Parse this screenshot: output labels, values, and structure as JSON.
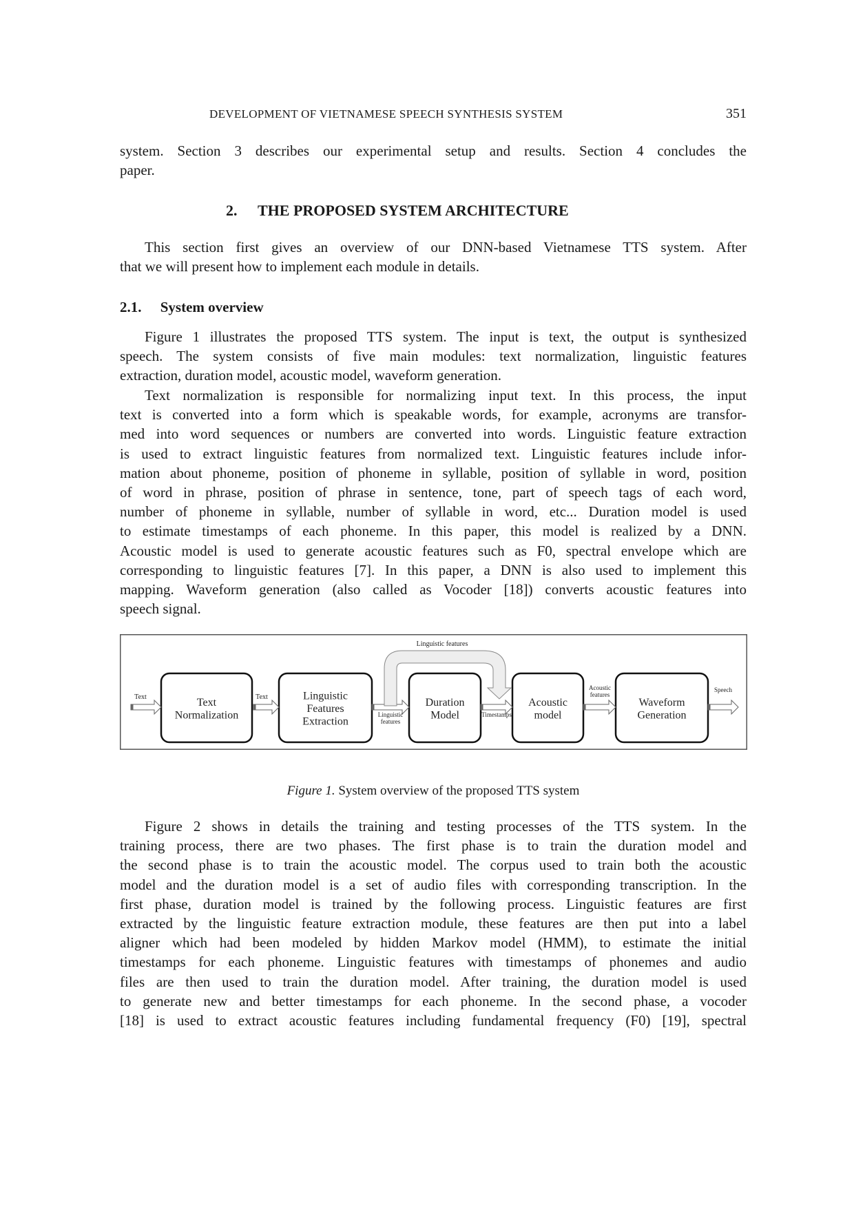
{
  "header": {
    "title": "DEVELOPMENT OF VIETNAMESE SPEECH SYNTHESIS SYSTEM",
    "page_number": "351"
  },
  "intro_tail": [
    "system.  Section 3 describes our experimental setup and results.  Section 4 concludes the",
    "paper."
  ],
  "section": {
    "number": "2.",
    "title": "THE PROPOSED SYSTEM ARCHITECTURE"
  },
  "section_para": [
    "This section first gives an overview of our DNN-based Vietnamese TTS system.  After",
    "that we will present how to implement each module in details."
  ],
  "subsection": {
    "number": "2.1.",
    "title": "System overview"
  },
  "para_overview": [
    "Figure 1 illustrates the proposed TTS system. The input is text, the output is synthesized",
    "speech.  The system consists of five main modules:  text normalization, linguistic features",
    "extraction, duration model, acoustic model, waveform generation."
  ],
  "para_modules": [
    "Text normalization is responsible for normalizing input text. In this process, the input",
    "text is converted into a form which is speakable words, for example, acronyms are transfor-",
    "med into word sequences or numbers are converted into words. Linguistic feature extraction",
    "is used to extract linguistic features from normalized text. Linguistic features include infor-",
    "mation about phoneme, position of phoneme in syllable, position of syllable in word, position",
    "of word in phrase, position of phrase in sentence, tone, part of speech tags of each word,",
    "number of phoneme in syllable, number of syllable in word, etc...  Duration model is used",
    "to estimate timestamps of each phoneme. In this paper, this model is realized by a DNN.",
    "Acoustic model is used to generate acoustic features such as F0, spectral envelope which are",
    "corresponding to linguistic features [7]. In this paper, a DNN is also used to implement this",
    "mapping. Waveform generation (also called as Vocoder [18]) converts acoustic features into",
    "speech signal."
  ],
  "figure": {
    "modules": [
      {
        "lines": [
          "Text",
          "Normalization"
        ]
      },
      {
        "lines": [
          "Linguistic",
          "Features",
          "Extraction"
        ]
      },
      {
        "lines": [
          "Duration",
          "Model"
        ]
      },
      {
        "lines": [
          "Acoustic",
          "model"
        ]
      },
      {
        "lines": [
          "Waveform",
          "Generation"
        ]
      }
    ],
    "arrow_labels": {
      "input": "Text",
      "text": "Text",
      "linguistic_1": "Linguistic",
      "linguistic_2": "features",
      "timestamps": "Timestamps",
      "acoustic_1": "Acoustic",
      "acoustic_2": "features",
      "speech": "Speech",
      "bypass": "Linguistic features"
    }
  },
  "caption": {
    "label": "Figure 1.",
    "text": "System overview of the proposed TTS system"
  },
  "para_training": [
    "Figure 2 shows in details the training and testing processes of the TTS system.  In the",
    "training process, there are two phases.  The first phase is to train the duration model and",
    "the second phase is to train the acoustic model.  The corpus used to train both the acoustic",
    "model and the duration model is a set of audio files with corresponding transcription. In the",
    "first phase, duration model is trained by the following process. Linguistic features are first",
    "extracted by the linguistic feature extraction module, these features are then put into a label",
    "aligner which had been modeled by hidden Markov model (HMM), to estimate the initial",
    "timestamps for each phoneme. Linguistic features with timestamps of phonemes and audio",
    "files are then used to train the duration model.  After training, the duration model is used",
    "to generate new and better timestamps for each phoneme. In the second phase, a vocoder",
    "[18] is used to extract acoustic features including fundamental frequency (F0) [19], spectral"
  ]
}
